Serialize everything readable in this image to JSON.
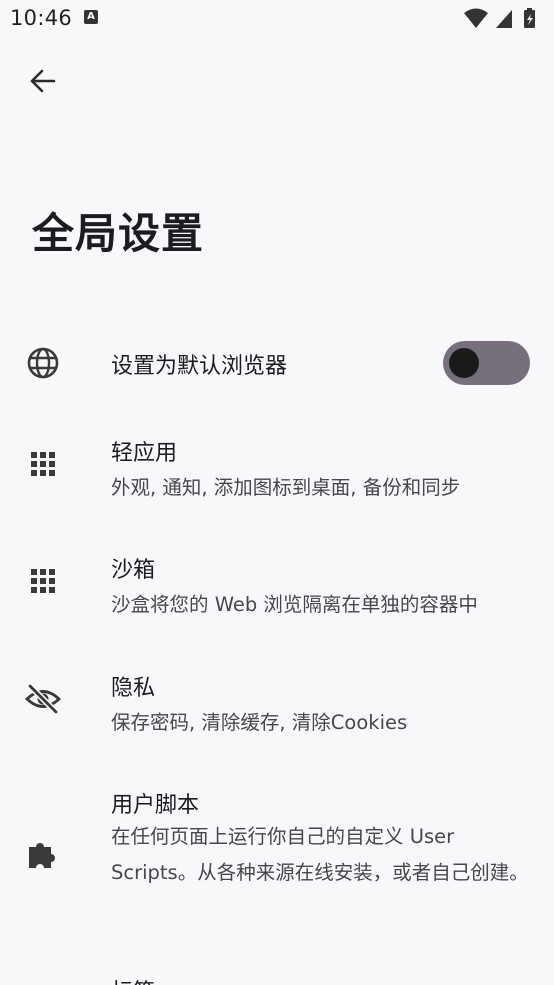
{
  "status_bar": {
    "time": "10:46",
    "notification_glyph": "A",
    "icons": [
      "wifi-icon",
      "cellular-signal-icon",
      "battery-icon"
    ]
  },
  "header": {
    "back_icon": "arrow-left-icon",
    "title": "全局设置"
  },
  "settings": {
    "items": [
      {
        "icon": "globe-icon",
        "title": "设置为默认浏览器",
        "toggle_on": false
      },
      {
        "icon": "apps-grid-icon",
        "title": "轻应用",
        "subtitle": "外观, 通知, 添加图标到桌面, 备份和同步"
      },
      {
        "icon": "apps-grid-icon",
        "title": "沙箱",
        "subtitle": "沙盒将您的 Web 浏览隔离在单独的容器中"
      },
      {
        "icon": "eye-off-icon",
        "title": "隐私",
        "subtitle": "保存密码, 清除缓存, 清除Cookies"
      },
      {
        "icon": "puzzle-icon",
        "title": "用户脚本",
        "subtitle": "在任何页面上运行你自己的自定义 User Scripts。从各种来源在线安装，或者自己创建。"
      },
      {
        "title": "标签"
      }
    ]
  },
  "colors": {
    "background": "#f8f8fa",
    "toggle_track": "#786f7d",
    "toggle_knob": "#1a1a1a",
    "icon": "#3a3a3c"
  }
}
